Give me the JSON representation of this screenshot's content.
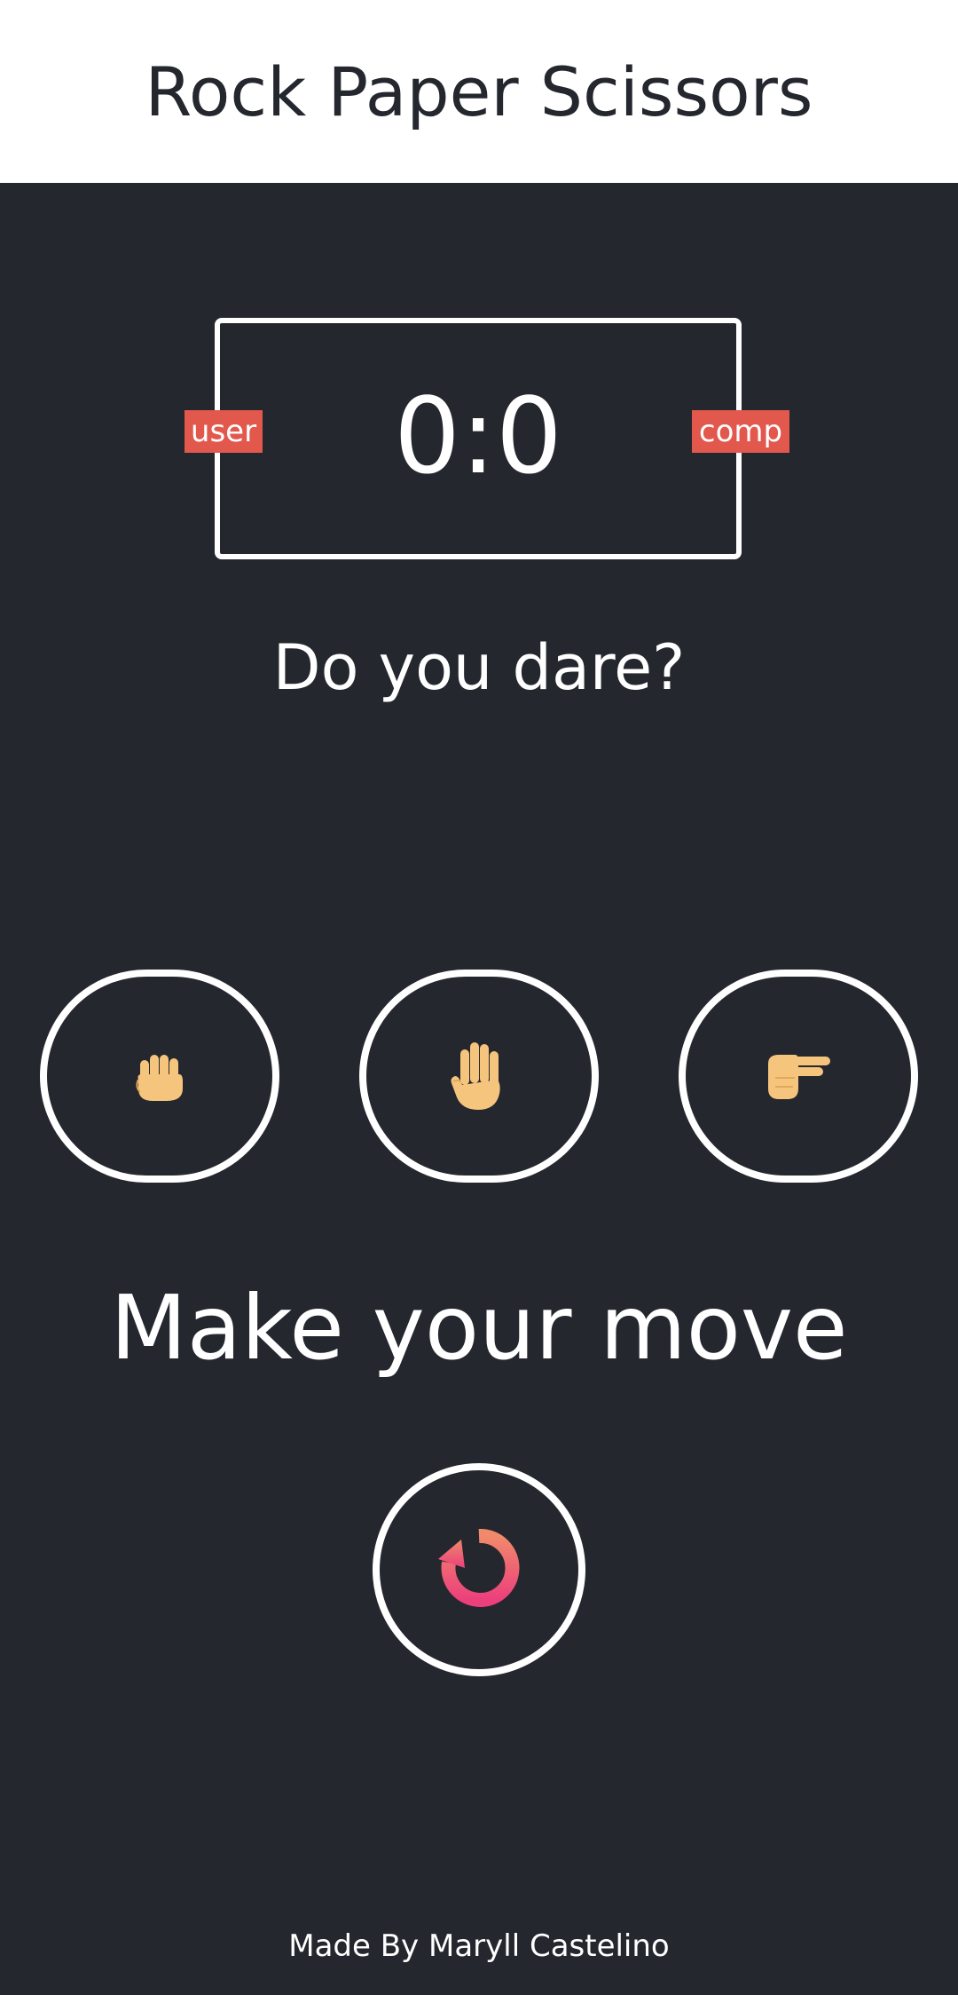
{
  "header": {
    "title": "Rock Paper Scissors"
  },
  "scoreboard": {
    "score": "0:0",
    "user_label": "user",
    "comp_label": "comp"
  },
  "message": "Do you dare?",
  "choices": [
    {
      "name": "rock",
      "icon": "raised-back-of-hand-icon"
    },
    {
      "name": "paper",
      "icon": "raised-hand-icon"
    },
    {
      "name": "scissors",
      "icon": "pointing-hand-icon"
    }
  ],
  "prompt": "Make your move",
  "reset": {
    "icon": "refresh-icon"
  },
  "footer": {
    "credit": "Made By Maryll Castelino"
  },
  "colors": {
    "background": "#24272e",
    "header_bg": "#ffffff",
    "badge": "#e2584d",
    "skin": "#f6c57d",
    "reset_gradient_start": "#f08a6b",
    "reset_gradient_end": "#ec3f7c"
  }
}
